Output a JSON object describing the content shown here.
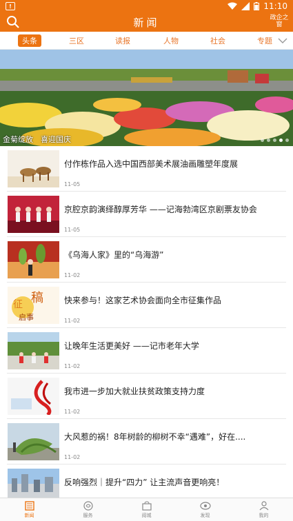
{
  "status_bar": {
    "time": "11:10"
  },
  "header": {
    "title": "新闻",
    "corner_text": "政企之窗"
  },
  "tabs": [
    {
      "label": "头条",
      "active": true
    },
    {
      "label": "三区",
      "active": false
    },
    {
      "label": "读报",
      "active": false
    },
    {
      "label": "人物",
      "active": false
    },
    {
      "label": "社会",
      "active": false
    },
    {
      "label": "专题",
      "active": false
    }
  ],
  "banner": {
    "caption": "金菊绽放　喜迎国庆",
    "slide_count": 5,
    "active_slide": 4
  },
  "news": [
    {
      "title": "付作栋作品入选中国西部美术展油画雕塑年度展",
      "date": "11-05",
      "thumb": "camels"
    },
    {
      "title": "京腔京韵演绎醇厚芳华 ——记海勃湾区京剧票友协会",
      "date": "11-05",
      "thumb": "stage"
    },
    {
      "title": "《乌海人家》里的“乌海游”",
      "date": "11-02",
      "thumb": "grapes"
    },
    {
      "title": "快来参与！这家艺术协会面向全市征集作品",
      "date": "11-02",
      "thumb": "calligraphy"
    },
    {
      "title": "让晚年生活更美好 ——记市老年大学",
      "date": "11-02",
      "thumb": "dance"
    },
    {
      "title": "我市进一步加大就业扶贫政策支持力度",
      "date": "11-02",
      "thumb": "ribbon"
    },
    {
      "title": "大风惹的祸！8年树龄的柳树不幸“遇难”，好在....",
      "date": "11-02",
      "thumb": "tree"
    },
    {
      "title": "反响强烈｜提升“四力” 让主流声音更响亮！",
      "date": "",
      "thumb": "city"
    }
  ],
  "bottom_nav": [
    {
      "label": "新闻",
      "icon": "news-icon",
      "active": true
    },
    {
      "label": "服务",
      "icon": "service-icon",
      "active": false
    },
    {
      "label": "阅城",
      "icon": "bag-icon",
      "active": false
    },
    {
      "label": "发现",
      "icon": "eye-icon",
      "active": false
    },
    {
      "label": "我的",
      "icon": "user-icon",
      "active": false
    }
  ],
  "colors": {
    "brand": "#ec7311"
  }
}
